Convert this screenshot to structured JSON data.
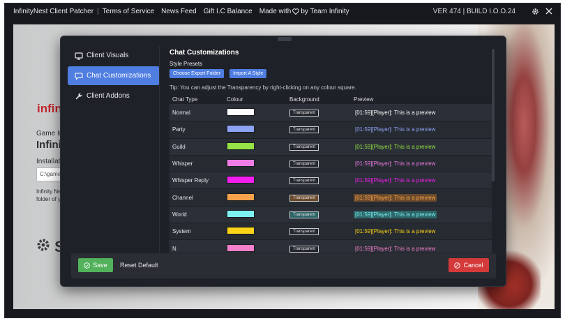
{
  "titlebar": {
    "app_name": "InfinityNest Client Patcher",
    "terms": "Terms of Service",
    "news": "News Feed",
    "gift": "Gift I.C Balance",
    "made_with_prefix": "Made with",
    "made_with_suffix": "by Team Infinity",
    "version": "VER 474 | BUILD I.O.O.24",
    "icons": [
      "gear-icon",
      "close-icon"
    ]
  },
  "background": {
    "logo_text": "infin",
    "game_label": "Game Ins",
    "game_title": "Infinit",
    "install_label": "Installation",
    "install_path": "C:\\games\\",
    "desc_line1": "Infinity Nest",
    "desc_line2": "folder of you",
    "brand_letter": "S"
  },
  "sidebar": {
    "items": [
      {
        "label": "Client Visuals",
        "icon": "monitor-icon",
        "active": false
      },
      {
        "label": "Chat Customizations",
        "icon": "chat-bubble-icon",
        "active": true
      },
      {
        "label": "Client Addons",
        "icon": "wrench-icon",
        "active": false
      }
    ]
  },
  "content": {
    "heading": "Chat Customizations",
    "presets_label": "Style Presets",
    "export_label": "Choose Export Folder",
    "import_label": "Import A Style",
    "tip": "Tip: You can adjust the Transparency by right-clicking on any colour square.",
    "columns": [
      "Chat Type",
      "Colour",
      "Background",
      "Preview"
    ],
    "bg_button_label": "Transparent",
    "preview_text": "[01:59][Player]: This is a preview",
    "rows": [
      {
        "type": "Normal",
        "colour": "#ffffff",
        "preview_color": "#ffffff",
        "preview_bg": ""
      },
      {
        "type": "Party",
        "colour": "#8da3f5",
        "preview_color": "#8da3f5",
        "preview_bg": ""
      },
      {
        "type": "Guild",
        "colour": "#96e346",
        "preview_color": "#96e346",
        "preview_bg": ""
      },
      {
        "type": "Whisper",
        "colour": "#f07ce6",
        "preview_color": "#f07ce6",
        "preview_bg": ""
      },
      {
        "type": "Whisper Reply",
        "colour": "#f51ef0",
        "preview_color": "#f51ef0",
        "preview_bg": ""
      },
      {
        "type": "Channel",
        "colour": "#f6a24a",
        "preview_color": "#f6a24a",
        "preview_bg": "#6b4a2c"
      },
      {
        "type": "World",
        "colour": "#7ef1f3",
        "preview_color": "#7ef1f3",
        "preview_bg": "#2c6468"
      },
      {
        "type": "System",
        "colour": "#fbd317",
        "preview_color": "#fbd317",
        "preview_bg": ""
      },
      {
        "type": "N",
        "colour": "#f47fca",
        "preview_color": "#f47fca",
        "preview_bg": ""
      }
    ]
  },
  "footer": {
    "save_label": "Save",
    "reset_label": "Reset Default",
    "cancel_label": "Cancel"
  }
}
